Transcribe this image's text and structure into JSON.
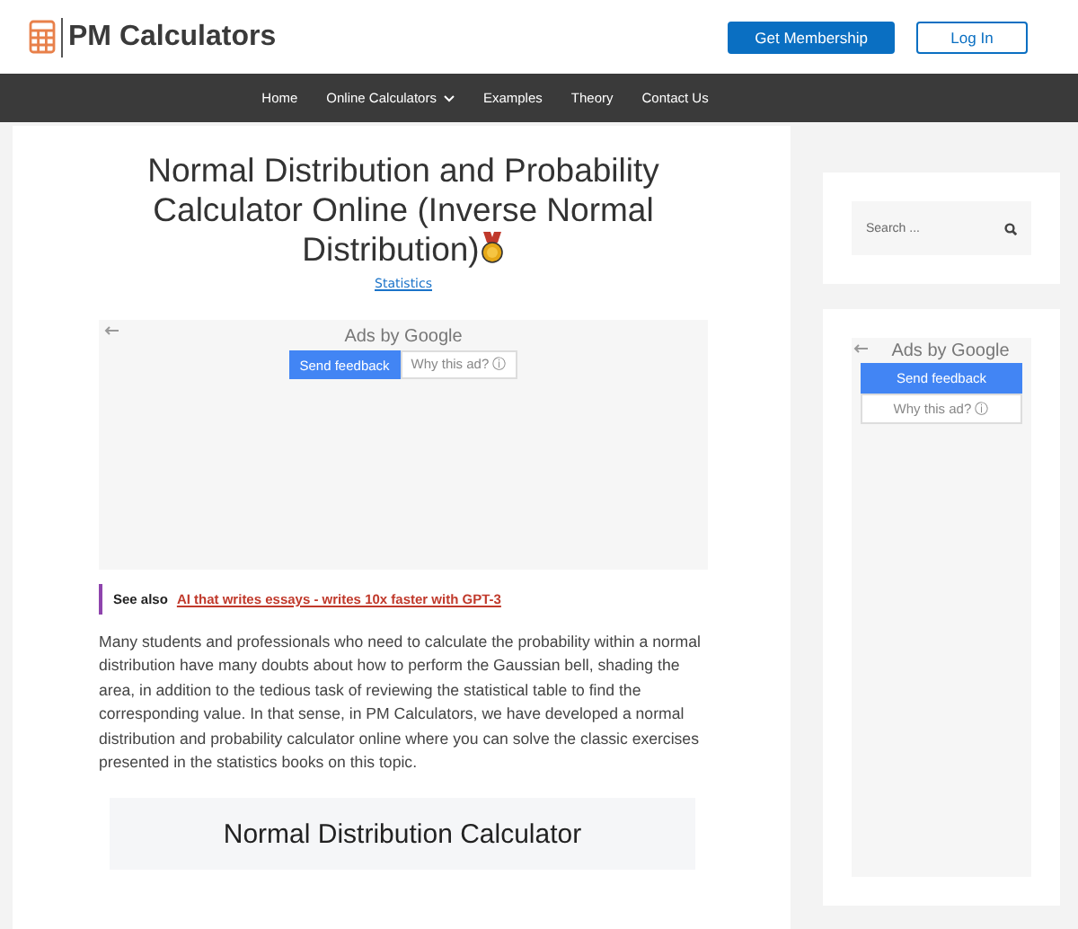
{
  "header": {
    "logo": "PM Calculators",
    "buttons": [
      {
        "label": "Get Membership",
        "kind": "primary"
      },
      {
        "label": "Log In",
        "kind": "outline"
      }
    ]
  },
  "nav": [
    {
      "label": "Home",
      "dropdown": false
    },
    {
      "label": "Online Calculators",
      "dropdown": true
    },
    {
      "label": "Examples",
      "dropdown": false
    },
    {
      "label": "Theory",
      "dropdown": false
    },
    {
      "label": "Contact Us",
      "dropdown": false
    }
  ],
  "article": {
    "title": "Normal Distribution and Probability Calculator Online (Inverse Normal Distribution)",
    "category": "Statistics",
    "ad": {
      "label": "Ads by Google",
      "feedback": "Send feedback",
      "why": "Why this ad? ⓘ"
    },
    "see_also": {
      "label": "See also",
      "link": "AI that writes essays - writes 10x faster with GPT-3"
    },
    "paragraph": "Many students and professionals who need to calculate the probability within a normal distribution have many doubts about how to perform the Gaussian bell, shading the area, in addition to the tedious task of reviewing the statistical table to find the corresponding value. In that sense, in PM Calculators, we have developed a normal distribution and probability calculator online where you can solve the classic exercises presented in the statistics books on this topic.",
    "calculator_heading": "Normal Distribution Calculator"
  },
  "sidebar": {
    "search": {
      "placeholder": "Search ..."
    },
    "ad": {
      "label": "Ads by Google",
      "feedback": "Send feedback",
      "why": "Why this ad? ⓘ"
    }
  }
}
